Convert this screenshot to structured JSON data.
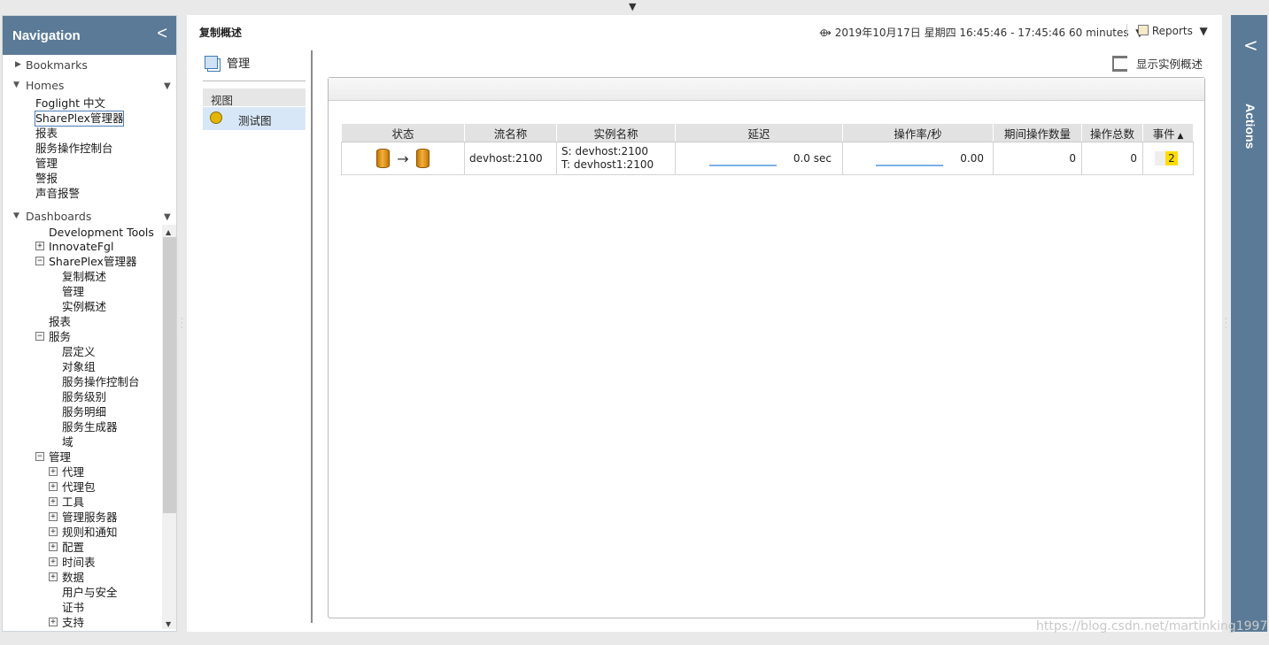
{
  "top_toggle": "▼",
  "nav": {
    "title": "Navigation",
    "collapse": "<",
    "bookmarks": "Bookmarks",
    "homes": "Homes",
    "home_items": [
      "Foglight 中文",
      "SharePlex管理器",
      "报表",
      "服务操作控制台",
      "管理",
      "警报",
      "声音报警"
    ],
    "dashboards": "Dashboards",
    "tree": {
      "dev_tools": "Development Tools",
      "innovate": "InnovateFgl",
      "shareplex": "SharePlex管理器",
      "sp_children": [
        "复制概述",
        "管理",
        "实例概述"
      ],
      "reports": "报表",
      "services": "服务",
      "svc_children": [
        "层定义",
        "对象组",
        "服务操作控制台",
        "服务级别",
        "服务明细",
        "服务生成器",
        "域"
      ],
      "admin": "管理",
      "admin_children": [
        "代理",
        "代理包",
        "工具",
        "管理服务器",
        "规则和通知",
        "配置",
        "时间表",
        "数据"
      ],
      "users": "用户与安全",
      "certs": "证书",
      "support": "支持"
    }
  },
  "header": {
    "title": "复制概述",
    "time_range": "2019年10月17日 星期四 16:45:46 - 17:45:46 60 minutes",
    "reports": "Reports"
  },
  "left_panel": {
    "manage": "管理",
    "view_header": "视图",
    "view_item": "测试图"
  },
  "show_instance": "显示实例概述",
  "table": {
    "columns": [
      "状态",
      "流名称",
      "实例名称",
      "延迟",
      "操作率/秒",
      "期间操作数量",
      "操作总数",
      "事件"
    ],
    "rows": [
      {
        "stream": "devhost:2100",
        "source": "S: devhost:2100",
        "target": "T: devhost1:2100",
        "latency": "0.0 sec",
        "rate": "0.00",
        "period_ops": "0",
        "total_ops": "0",
        "events": "2"
      }
    ]
  },
  "actions": "Actions",
  "watermark": "https://blog.csdn.net/martinking1997",
  "colors": {
    "nav_header": "#5a7a97",
    "selected_view": "#d8e7f7",
    "event_badge": "#ffdd00"
  }
}
